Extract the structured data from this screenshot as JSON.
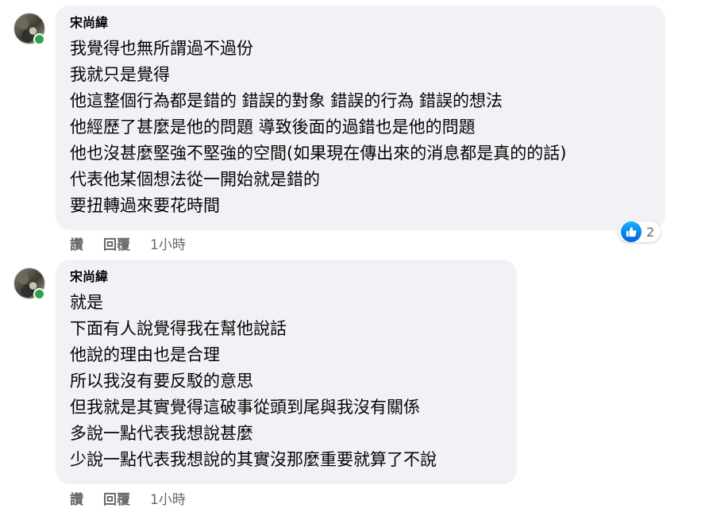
{
  "comments": [
    {
      "author": "宋尚緯",
      "lines": [
        "我覺得也無所謂過不過份",
        "我就只是覺得",
        "他這整個行為都是錯的 錯誤的對象 錯誤的行為 錯誤的想法",
        "他經歷了甚麼是他的問題 導致後面的過錯也是他的問題",
        "他也沒甚麼堅強不堅強的空間(如果現在傳出來的消息都是真的的話)",
        "代表他某個想法從一開始就是錯的",
        "要扭轉過來要花時間"
      ],
      "reaction_icon": "like-icon",
      "reaction_count": "2",
      "actions": {
        "like_label": "讚",
        "reply_label": "回覆",
        "time": "1小時"
      }
    },
    {
      "author": "宋尚緯",
      "lines": [
        "就是",
        "下面有人說覺得我在幫他說話",
        "他說的理由也是合理",
        "所以我沒有要反駁的意思",
        "但我就是其實覺得這破事從頭到尾與我沒有關係",
        "多說一點代表我想說甚麼",
        "少說一點代表我想說的其實沒那麼重要就算了不說"
      ],
      "actions": {
        "like_label": "讚",
        "reply_label": "回覆",
        "time": "1小時"
      }
    }
  ],
  "colors": {
    "bubble_bg": "#f0f2f5",
    "secondary_text": "#65676b",
    "online": "#31a24c",
    "like_blue": "#1877f2"
  }
}
